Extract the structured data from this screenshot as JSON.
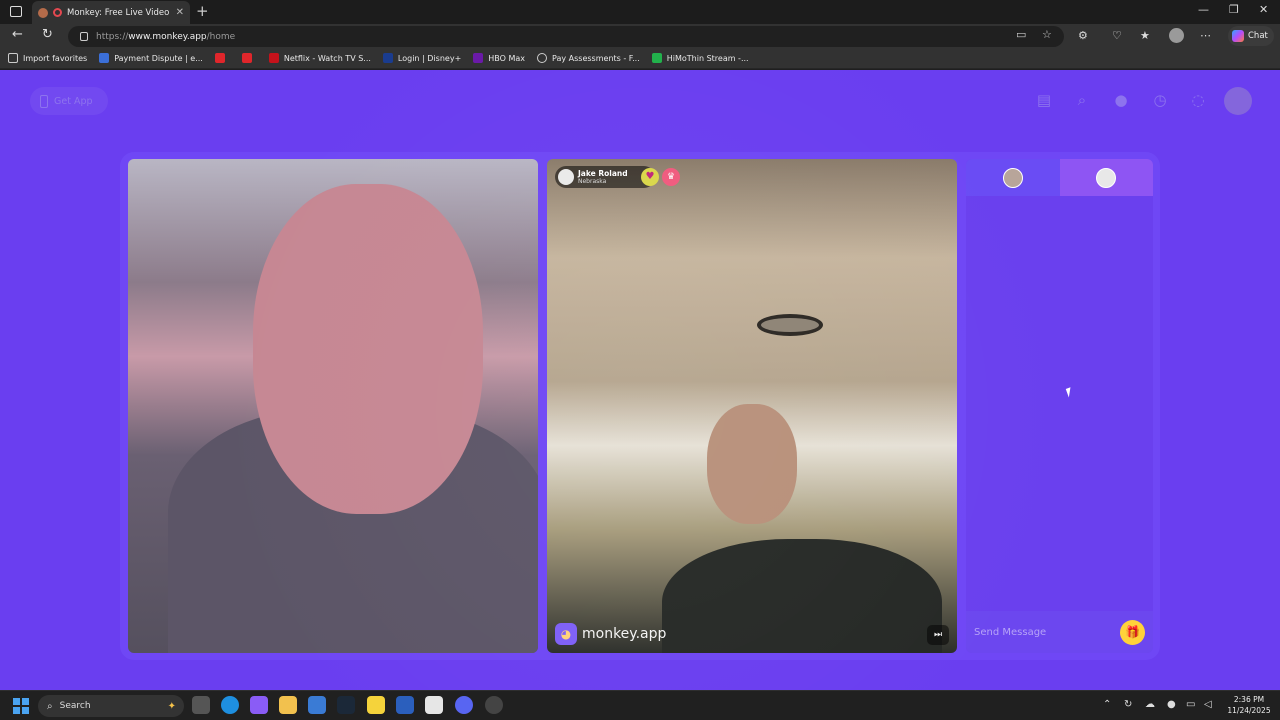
{
  "browser": {
    "tab_title": "Monkey: Free Live Video Ch...",
    "new_tab_symbol": "+",
    "url_prefix": "https://",
    "url_domain": "www.monkey.app",
    "url_path": "/home",
    "chat_label": "Chat"
  },
  "favorites": [
    {
      "label": "Import favorites",
      "color": "#cccccc"
    },
    {
      "label": "Payment Dispute | e...",
      "color": "#3b6fd8"
    },
    {
      "label": "",
      "color": "#e0262b"
    },
    {
      "label": "",
      "color": "#e0262b"
    },
    {
      "label": "Netflix - Watch TV S...",
      "color": "#c4121b"
    },
    {
      "label": "Login | Disney+",
      "color": "#1a3c8f"
    },
    {
      "label": "HBO Max",
      "color": "#6a1aa8"
    },
    {
      "label": "Pay Assessments - F...",
      "color": "#cccccc"
    },
    {
      "label": "HiMoThin Stream -...",
      "color": "#22b14c"
    }
  ],
  "page": {
    "get_app_label": "Get App",
    "remote_user": {
      "name": "Jake Roland",
      "location": "Nebraska"
    },
    "brand_label": "monkey.app",
    "message_placeholder": "Send Message"
  },
  "taskbar": {
    "search_label": "Search",
    "time": "2:36 PM",
    "date": "11/24/2025"
  },
  "colors": {
    "page_background": "#6a3ef0",
    "chat_panel": "#6a40ee",
    "gift_button": "#ffd23a"
  }
}
